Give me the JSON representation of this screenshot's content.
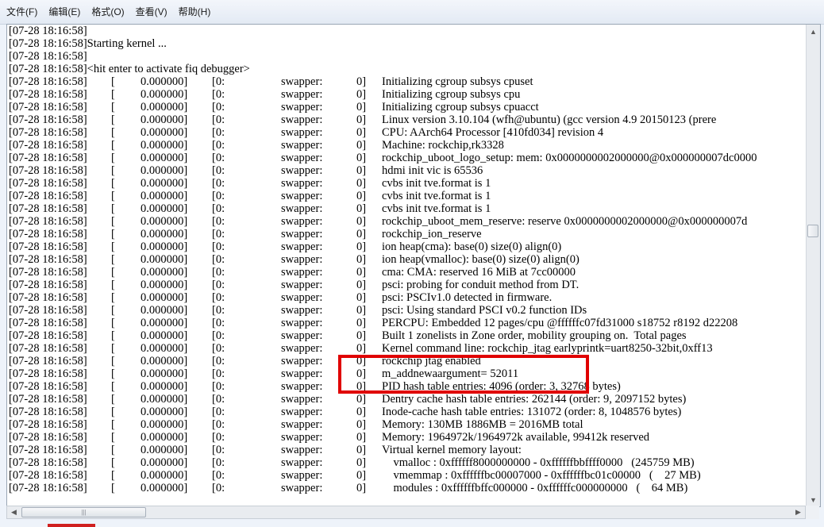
{
  "menu": [
    "文件(F)",
    "编辑(E)",
    "格式(O)",
    "查看(V)",
    "帮助(H)"
  ],
  "plain_lines": [
    "[07-28 18:16:58]",
    "[07-28 18:16:58]Starting kernel ...",
    "[07-28 18:16:58]",
    "[07-28 18:16:58]<hit enter to activate fiq debugger>"
  ],
  "log_prefix": {
    "timestamp": "[07-28 18:16:58]",
    "bracket": "[",
    "time": "0.000000]",
    "cpu": "[0:",
    "task": "swapper:",
    "pid": "0]"
  },
  "log_messages": [
    "Initializing cgroup subsys cpuset",
    "Initializing cgroup subsys cpu",
    "Initializing cgroup subsys cpuacct",
    "Linux version 3.10.104 (wfh@ubuntu) (gcc version 4.9 20150123 (prere",
    "CPU: AArch64 Processor [410fd034] revision 4",
    "Machine: rockchip,rk3328",
    "rockchip_uboot_logo_setup: mem: 0x0000000002000000@0x000000007dc0000",
    "hdmi init vic is 65536",
    "cvbs init tve.format is 1",
    "cvbs init tve.format is 1",
    "cvbs init tve.format is 1",
    "rockchip_uboot_mem_reserve: reserve 0x0000000002000000@0x000000007d",
    "rockchip_ion_reserve",
    "ion heap(cma): base(0) size(0) align(0)",
    "ion heap(vmalloc): base(0) size(0) align(0)",
    "cma: CMA: reserved 16 MiB at 7cc00000",
    "psci: probing for conduit method from DT.",
    "psci: PSCIv1.0 detected in firmware.",
    "psci: Using standard PSCI v0.2 function IDs",
    "PERCPU: Embedded 12 pages/cpu @ffffffc07fd31000 s18752 r8192 d22208",
    "Built 1 zonelists in Zone order, mobility grouping on.  Total pages",
    "Kernel command line: rockchip_jtag earlyprintk=uart8250-32bit,0xff13",
    "rockchip jtag enabled",
    "m_addnewaargument= 52011",
    "PID hash table entries: 4096 (order: 3, 32768 bytes)",
    "Dentry cache hash table entries: 262144 (order: 9, 2097152 bytes)",
    "Inode-cache hash table entries: 131072 (order: 8, 1048576 bytes)",
    "Memory: 130MB 1886MB = 2016MB total",
    "Memory: 1964972k/1964972k available, 99412k reserved",
    "Virtual kernel memory layout:",
    "    vmalloc : 0xffffff8000000000 - 0xffffffbbffff0000   (245759 MB)",
    "    vmemmap : 0xffffffbc00007000 - 0xffffffbc01c00000   (    27 MB)",
    "    modules : 0xffffffbffc000000 - 0xffffffc000000000   (    64 MB)"
  ],
  "scroll_up_arrow": "▲",
  "scroll_down_arrow": "▼",
  "scroll_left_arrow": "◀",
  "scroll_right_arrow": "▶",
  "hthumb_grip": "|||",
  "highlight_color": "#e00000"
}
